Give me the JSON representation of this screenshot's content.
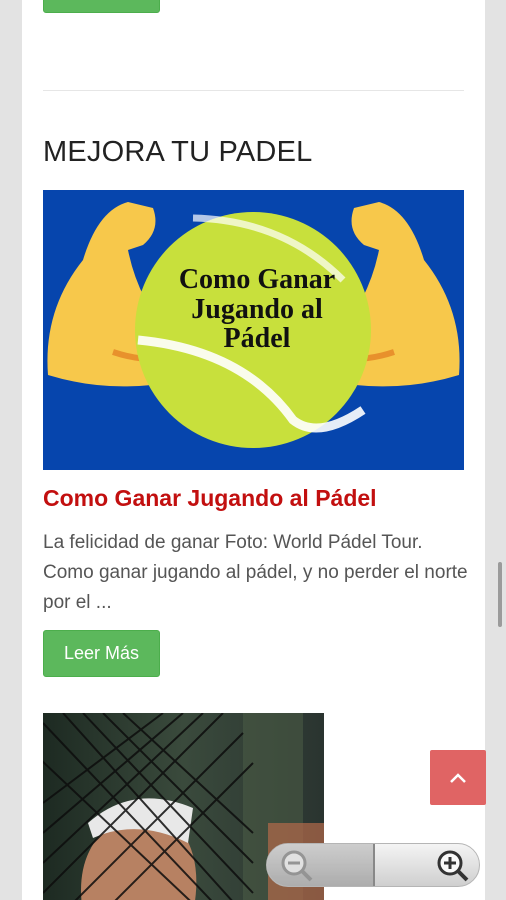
{
  "section": {
    "title": "MEJORA TU PADEL"
  },
  "hero_image": {
    "line1": "Como Ganar",
    "line2": "Jugando al",
    "line3": "Pádel",
    "colors": {
      "background": "#0645ad",
      "ball": "#c8e03c",
      "arms": "#f7c84b"
    }
  },
  "post": {
    "title": "Como Ganar Jugando al Pádel",
    "excerpt": "La felicidad de ganar Foto: World Pádel Tour. Como ganar jugando al pádel, y no perder el norte por el ...",
    "read_more": "Leer Más"
  },
  "colors": {
    "accent_red": "#c20f0f",
    "button_green": "#5cb85c",
    "back_to_top": "#e06464"
  },
  "icons": {
    "back_to_top": "chevron-up-icon",
    "zoom_out": "zoom-out-icon",
    "zoom_in": "zoom-in-icon"
  }
}
